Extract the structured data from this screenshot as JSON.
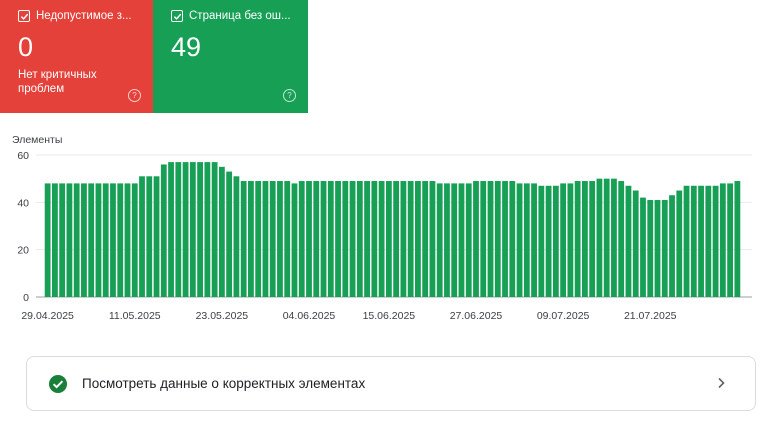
{
  "cards": {
    "error": {
      "title": "Недопустимое з...",
      "value": "0",
      "subtitle": "Нет критичных проблем",
      "checked": true,
      "color": "#e4413a"
    },
    "valid": {
      "title": "Страница без ош...",
      "value": "49",
      "checked": true,
      "color": "#17a055"
    }
  },
  "chart_data": {
    "type": "bar",
    "ylabel": "Элементы",
    "ylim": [
      0,
      60
    ],
    "yticks": [
      0,
      20,
      40,
      60
    ],
    "grid": true,
    "bar_color": "#17a055",
    "xtick_labels": [
      "29.04.2025",
      "11.05.2025",
      "23.05.2025",
      "04.06.2025",
      "15.06.2025",
      "27.06.2025",
      "09.07.2025",
      "21.07.2025"
    ],
    "xtick_indices": [
      0,
      12,
      24,
      36,
      47,
      59,
      71,
      83
    ],
    "values": [
      48,
      48,
      48,
      48,
      48,
      48,
      48,
      48,
      48,
      48,
      48,
      48,
      48,
      51,
      51,
      51,
      56,
      57,
      57,
      57,
      57,
      57,
      57,
      57,
      55,
      53,
      51,
      49,
      49,
      49,
      49,
      49,
      49,
      49,
      48,
      49,
      49,
      49,
      49,
      49,
      49,
      49,
      49,
      49,
      49,
      49,
      49,
      49,
      49,
      49,
      49,
      49,
      49,
      49,
      48,
      48,
      48,
      48,
      48,
      49,
      49,
      49,
      49,
      49,
      49,
      48,
      48,
      48,
      47,
      47,
      47,
      48,
      48,
      49,
      49,
      49,
      50,
      50,
      50,
      49,
      47,
      45,
      42,
      41,
      41,
      41,
      43,
      45,
      47,
      47,
      47,
      47,
      47,
      48,
      48,
      49
    ]
  },
  "link_row": {
    "label": "Посмотреть данные о корректных элементах"
  }
}
